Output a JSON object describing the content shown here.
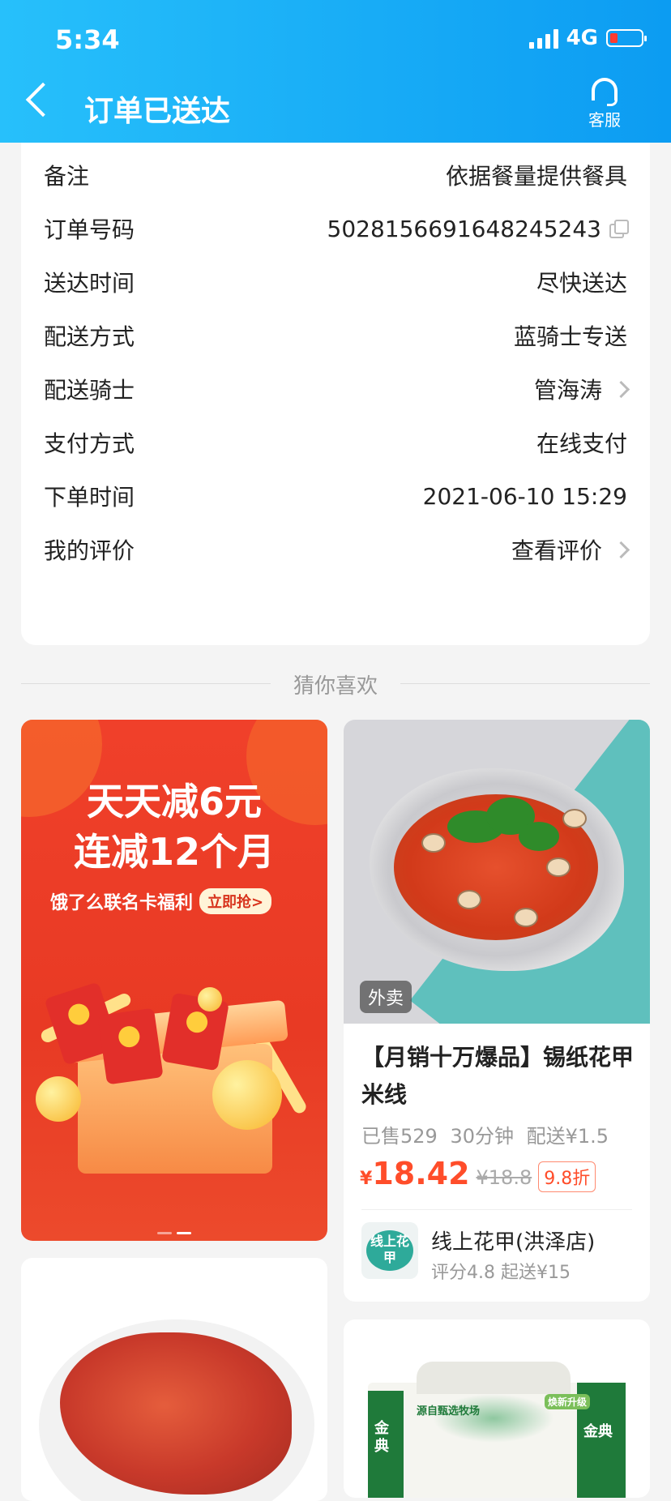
{
  "status_bar": {
    "time": "5:34",
    "network": "4G"
  },
  "header": {
    "title": "订单已送达",
    "service_label": "客服"
  },
  "order_info": [
    {
      "label": "备注",
      "value": "依据餐量提供餐具"
    },
    {
      "label": "订单号码",
      "value": "5028156691648245243"
    },
    {
      "label": "送达时间",
      "value": "尽快送达"
    },
    {
      "label": "配送方式",
      "value": "蓝骑士专送"
    },
    {
      "label": "配送骑士",
      "value": "管海涛"
    },
    {
      "label": "支付方式",
      "value": "在线支付"
    },
    {
      "label": "下单时间",
      "value": "2021-06-10 15:29"
    },
    {
      "label": "我的评价",
      "value": "查看评价"
    }
  ],
  "recommend": {
    "title": "猜你喜欢"
  },
  "banner": {
    "line1": "天天减6元",
    "line2": "连减12个月",
    "subtitle": "饿了么联名卡福利",
    "cta": "立即抢>"
  },
  "product": {
    "tag": "外卖",
    "title": "【月销十万爆品】锡纸花甲米线",
    "sold": "已售529",
    "time": "30分钟",
    "delivery": "配送¥1.5",
    "currency": "¥",
    "price": "18.42",
    "original_price": "¥18.8",
    "discount": "9.8折",
    "shop_logo_text": "线上花甲",
    "shop_name": "线上花甲(洪泽店)",
    "shop_meta": "评分4.8 起送¥15"
  },
  "milk_card": {
    "brand": "金典",
    "label": "源自甄选牧场",
    "badge": "焕新升级"
  },
  "colors": {
    "header_start": "#27c0fb",
    "header_end": "#0c9cf2",
    "price": "#ff4d2a",
    "banner": "#e83a24"
  }
}
